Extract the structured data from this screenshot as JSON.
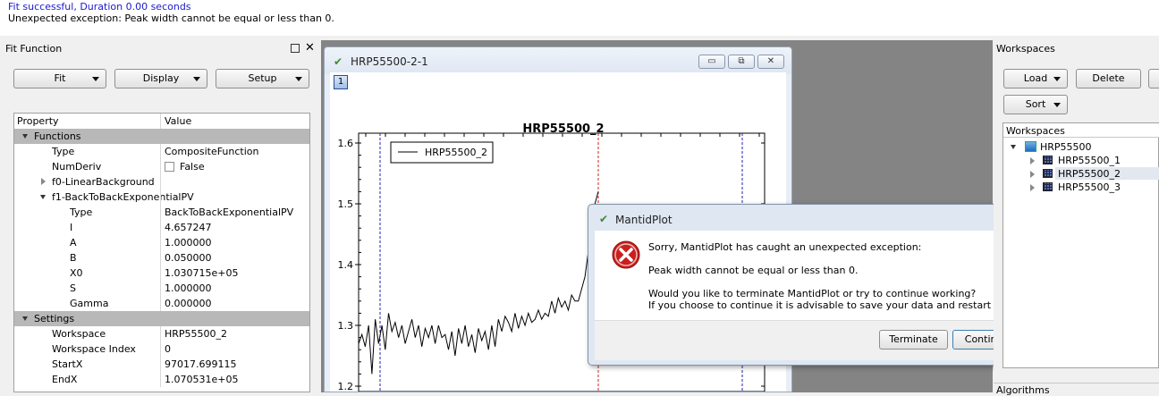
{
  "messages": {
    "line1": "Fit successful, Duration 0.00 seconds",
    "line2": "Unexpected exception: Peak width cannot be equal or less than 0."
  },
  "fit_panel": {
    "title": "Fit Function",
    "buttons": {
      "fit": "Fit",
      "display": "Display",
      "setup": "Setup"
    },
    "table": {
      "header_property": "Property",
      "header_value": "Value",
      "rows": [
        {
          "key": "Functions",
          "value": "",
          "kind": "group"
        },
        {
          "key": "Type",
          "value": "CompositeFunction",
          "kind": "prop"
        },
        {
          "key": "NumDeriv",
          "value": "False",
          "kind": "checkbox"
        },
        {
          "key": "f0-LinearBackground",
          "value": "",
          "kind": "collapsed"
        },
        {
          "key": "f1-BackToBackExponentialPV",
          "value": "",
          "kind": "expanded"
        },
        {
          "key": "Type",
          "value": "BackToBackExponentialPV",
          "kind": "sub"
        },
        {
          "key": "I",
          "value": "4.657247",
          "kind": "sub"
        },
        {
          "key": "A",
          "value": "1.000000",
          "kind": "sub"
        },
        {
          "key": "B",
          "value": "0.050000",
          "kind": "sub"
        },
        {
          "key": "X0",
          "value": "1.030715e+05",
          "kind": "sub"
        },
        {
          "key": "S",
          "value": "1.000000",
          "kind": "sub"
        },
        {
          "key": "Gamma",
          "value": "0.000000",
          "kind": "sub"
        },
        {
          "key": "Settings",
          "value": "",
          "kind": "group"
        },
        {
          "key": "Workspace",
          "value": "HRP55500_2",
          "kind": "prop"
        },
        {
          "key": "Workspace Index",
          "value": "0",
          "kind": "prop"
        },
        {
          "key": "StartX",
          "value": "97017.699115",
          "kind": "prop"
        },
        {
          "key": "EndX",
          "value": "1.070531e+05",
          "kind": "prop"
        }
      ]
    }
  },
  "plot_window": {
    "title": "HRP55500-2-1",
    "layer_button": "1",
    "window_buttons": {
      "minimize": "▭",
      "restore": "⧉",
      "close": "✕"
    },
    "plot_title": "HRP55500_2",
    "legend_label": "HRP55500_2"
  },
  "chart_data": {
    "type": "line",
    "title": "HRP55500_2",
    "xlabel": "",
    "ylabel": "",
    "ylim": [
      1.2,
      1.6
    ],
    "yticks": [
      "1.6",
      "1.5",
      "1.4",
      "1.3",
      "1.2"
    ],
    "series": [
      {
        "name": "HRP55500_2",
        "values": [
          1.27,
          1.285,
          1.265,
          1.3,
          1.22,
          1.31,
          1.27,
          1.3,
          1.26,
          1.32,
          1.29,
          1.305,
          1.28,
          1.3,
          1.27,
          1.29,
          1.31,
          1.28,
          1.3,
          1.265,
          1.295,
          1.28,
          1.3,
          1.27,
          1.3,
          1.28,
          1.285,
          1.26,
          1.29,
          1.25,
          1.295,
          1.27,
          1.3,
          1.265,
          1.285,
          1.255,
          1.295,
          1.275,
          1.29,
          1.26,
          1.3,
          1.265,
          1.31,
          1.29,
          1.315,
          1.305,
          1.29,
          1.32,
          1.295,
          1.315,
          1.3,
          1.32,
          1.305,
          1.31,
          1.325,
          1.31,
          1.32,
          1.315,
          1.34,
          1.32,
          1.345,
          1.33,
          1.34,
          1.325,
          1.35,
          1.34,
          1.34,
          1.36,
          1.38,
          1.42,
          1.46,
          1.5,
          1.52
        ]
      }
    ],
    "markers": {
      "colors": [
        "#2020b0",
        "#d02020"
      ]
    },
    "colors": {
      "line": "#000000"
    }
  },
  "dialog": {
    "title": "MantidPlot",
    "message1": "Sorry, MantidPlot has caught an unexpected exception:",
    "message2": "Peak width cannot be equal or less than 0.",
    "message3": "Would you like to terminate MantidPlot or try to continue working?",
    "message4": "If you choose to continue it is advisable to save your data and restart the application.",
    "terminate": "Terminate",
    "continue": "Continue",
    "close": "✕"
  },
  "workspaces_panel": {
    "title": "Workspaces",
    "load": "Load",
    "delete": "Delete",
    "sort": "Sort",
    "tree_header": "Workspaces",
    "group": "HRP55500",
    "items": [
      "HRP55500_1",
      "HRP55500_2",
      "HRP55500_3"
    ],
    "selected_index": 1
  },
  "algorithms_panel": {
    "title": "Algorithms"
  }
}
